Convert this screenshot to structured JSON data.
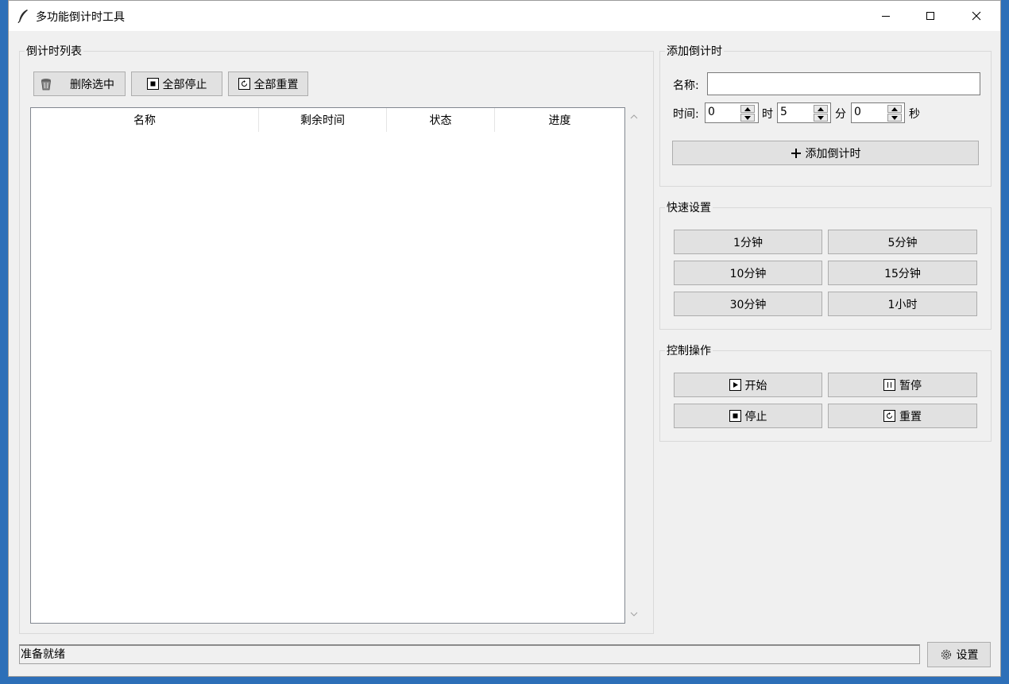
{
  "window": {
    "title": "多功能倒计时工具"
  },
  "list_group": {
    "label": "倒计时列表",
    "delete_label": "删除选中",
    "stop_all_label": "全部停止",
    "reset_all_label": "全部重置",
    "columns": [
      "名称",
      "剩余时间",
      "状态",
      "进度"
    ]
  },
  "add_group": {
    "label": "添加倒计时",
    "name_label": "名称:",
    "name_value": "",
    "time_label": "时间:",
    "hours_value": "0",
    "hours_unit": "时",
    "minutes_value": "5",
    "minutes_unit": "分",
    "seconds_value": "0",
    "seconds_unit": "秒",
    "add_button_label": "添加倒计时"
  },
  "quick_group": {
    "label": "快速设置",
    "presets": [
      "1分钟",
      "5分钟",
      "10分钟",
      "15分钟",
      "30分钟",
      "1小时"
    ]
  },
  "control_group": {
    "label": "控制操作",
    "start_label": "开始",
    "pause_label": "暂停",
    "stop_label": "停止",
    "reset_label": "重置"
  },
  "status": {
    "text": "准备就绪"
  },
  "settings_label": "设置",
  "icons": {
    "app": "feather-icon",
    "delete": "trash-icon",
    "stop": "stop-icon",
    "reset": "reset-icon",
    "add": "plus-icon",
    "start": "play-icon",
    "pause": "pause-icon",
    "settings": "gear-icon"
  },
  "colors": {
    "desktop": "#2d6fb8",
    "window_bg": "#f0f0f0",
    "button_bg": "#e1e1e1"
  }
}
